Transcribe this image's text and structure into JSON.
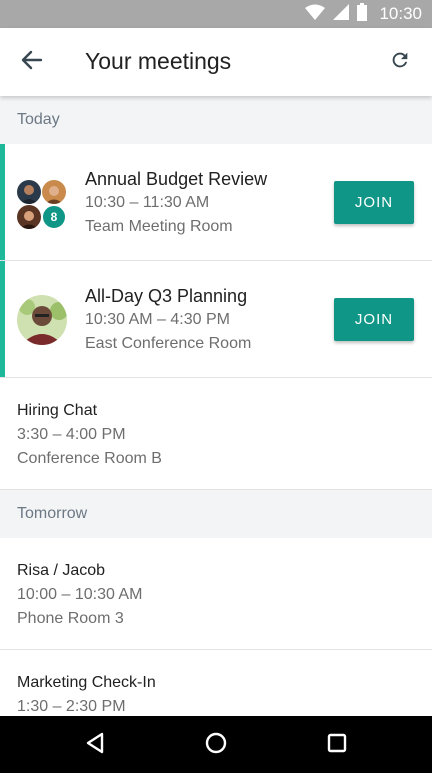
{
  "status_bar": {
    "time": "10:30",
    "icons": [
      "wifi-icon",
      "signal-icon",
      "battery-icon"
    ]
  },
  "app_bar": {
    "title": "Your meetings",
    "back_icon": "arrow-left-icon",
    "refresh_icon": "refresh-icon"
  },
  "sections": {
    "today": "Today",
    "tomorrow": "Tomorrow"
  },
  "meetings_today": [
    {
      "title": "Annual Budget Review",
      "time": "10:30 – 11:30 AM",
      "location": "Team Meeting Room",
      "join_label": "JOIN",
      "extra_attendees": "8"
    },
    {
      "title": "All-Day Q3 Planning",
      "time": "10:30 AM – 4:30 PM",
      "location": "East Conference Room",
      "join_label": "JOIN"
    },
    {
      "title": "Hiring Chat",
      "time": "3:30 – 4:00 PM",
      "location": "Conference Room B"
    }
  ],
  "meetings_tomorrow": [
    {
      "title": "Risa / Jacob",
      "time": "10:00 – 10:30 AM",
      "location": "Phone Room 3"
    },
    {
      "title": "Marketing Check-In",
      "time": "1:30 – 2:30 PM"
    }
  ],
  "colors": {
    "accent": "#1eb89a",
    "join_button": "#0f9687",
    "section_bg": "#f3f4f5",
    "section_text": "#6c7885",
    "status_bar": "#a8a8a8"
  },
  "nav_bar": {
    "icons": [
      "back-triangle-icon",
      "home-circle-icon",
      "recents-square-icon"
    ]
  }
}
